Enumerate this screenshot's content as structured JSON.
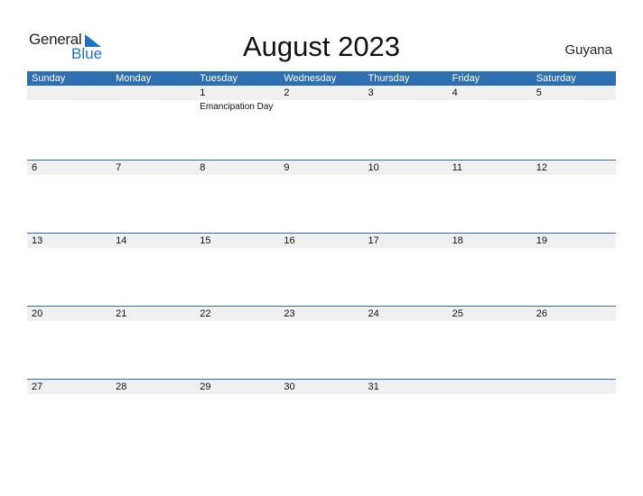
{
  "logo": {
    "general": "General",
    "blue": "Blue"
  },
  "title": "August 2023",
  "country": "Guyana",
  "weekdays": [
    "Sunday",
    "Monday",
    "Tuesday",
    "Wednesday",
    "Thursday",
    "Friday",
    "Saturday"
  ],
  "weeks": [
    {
      "days": [
        "",
        "",
        "1",
        "2",
        "3",
        "4",
        "5"
      ],
      "events": [
        "",
        "",
        "Emancipation Day",
        "",
        "",
        "",
        ""
      ]
    },
    {
      "days": [
        "6",
        "7",
        "8",
        "9",
        "10",
        "11",
        "12"
      ],
      "events": [
        "",
        "",
        "",
        "",
        "",
        "",
        ""
      ]
    },
    {
      "days": [
        "13",
        "14",
        "15",
        "16",
        "17",
        "18",
        "19"
      ],
      "events": [
        "",
        "",
        "",
        "",
        "",
        "",
        ""
      ]
    },
    {
      "days": [
        "20",
        "21",
        "22",
        "23",
        "24",
        "25",
        "26"
      ],
      "events": [
        "",
        "",
        "",
        "",
        "",
        "",
        ""
      ]
    },
    {
      "days": [
        "27",
        "28",
        "29",
        "30",
        "31",
        "",
        ""
      ],
      "events": [
        "",
        "",
        "",
        "",
        "",
        "",
        ""
      ]
    }
  ],
  "colors": {
    "accent": "#2e6fb1",
    "date_strip": "#f0f0f0",
    "logo_blue": "#1f73c0"
  }
}
